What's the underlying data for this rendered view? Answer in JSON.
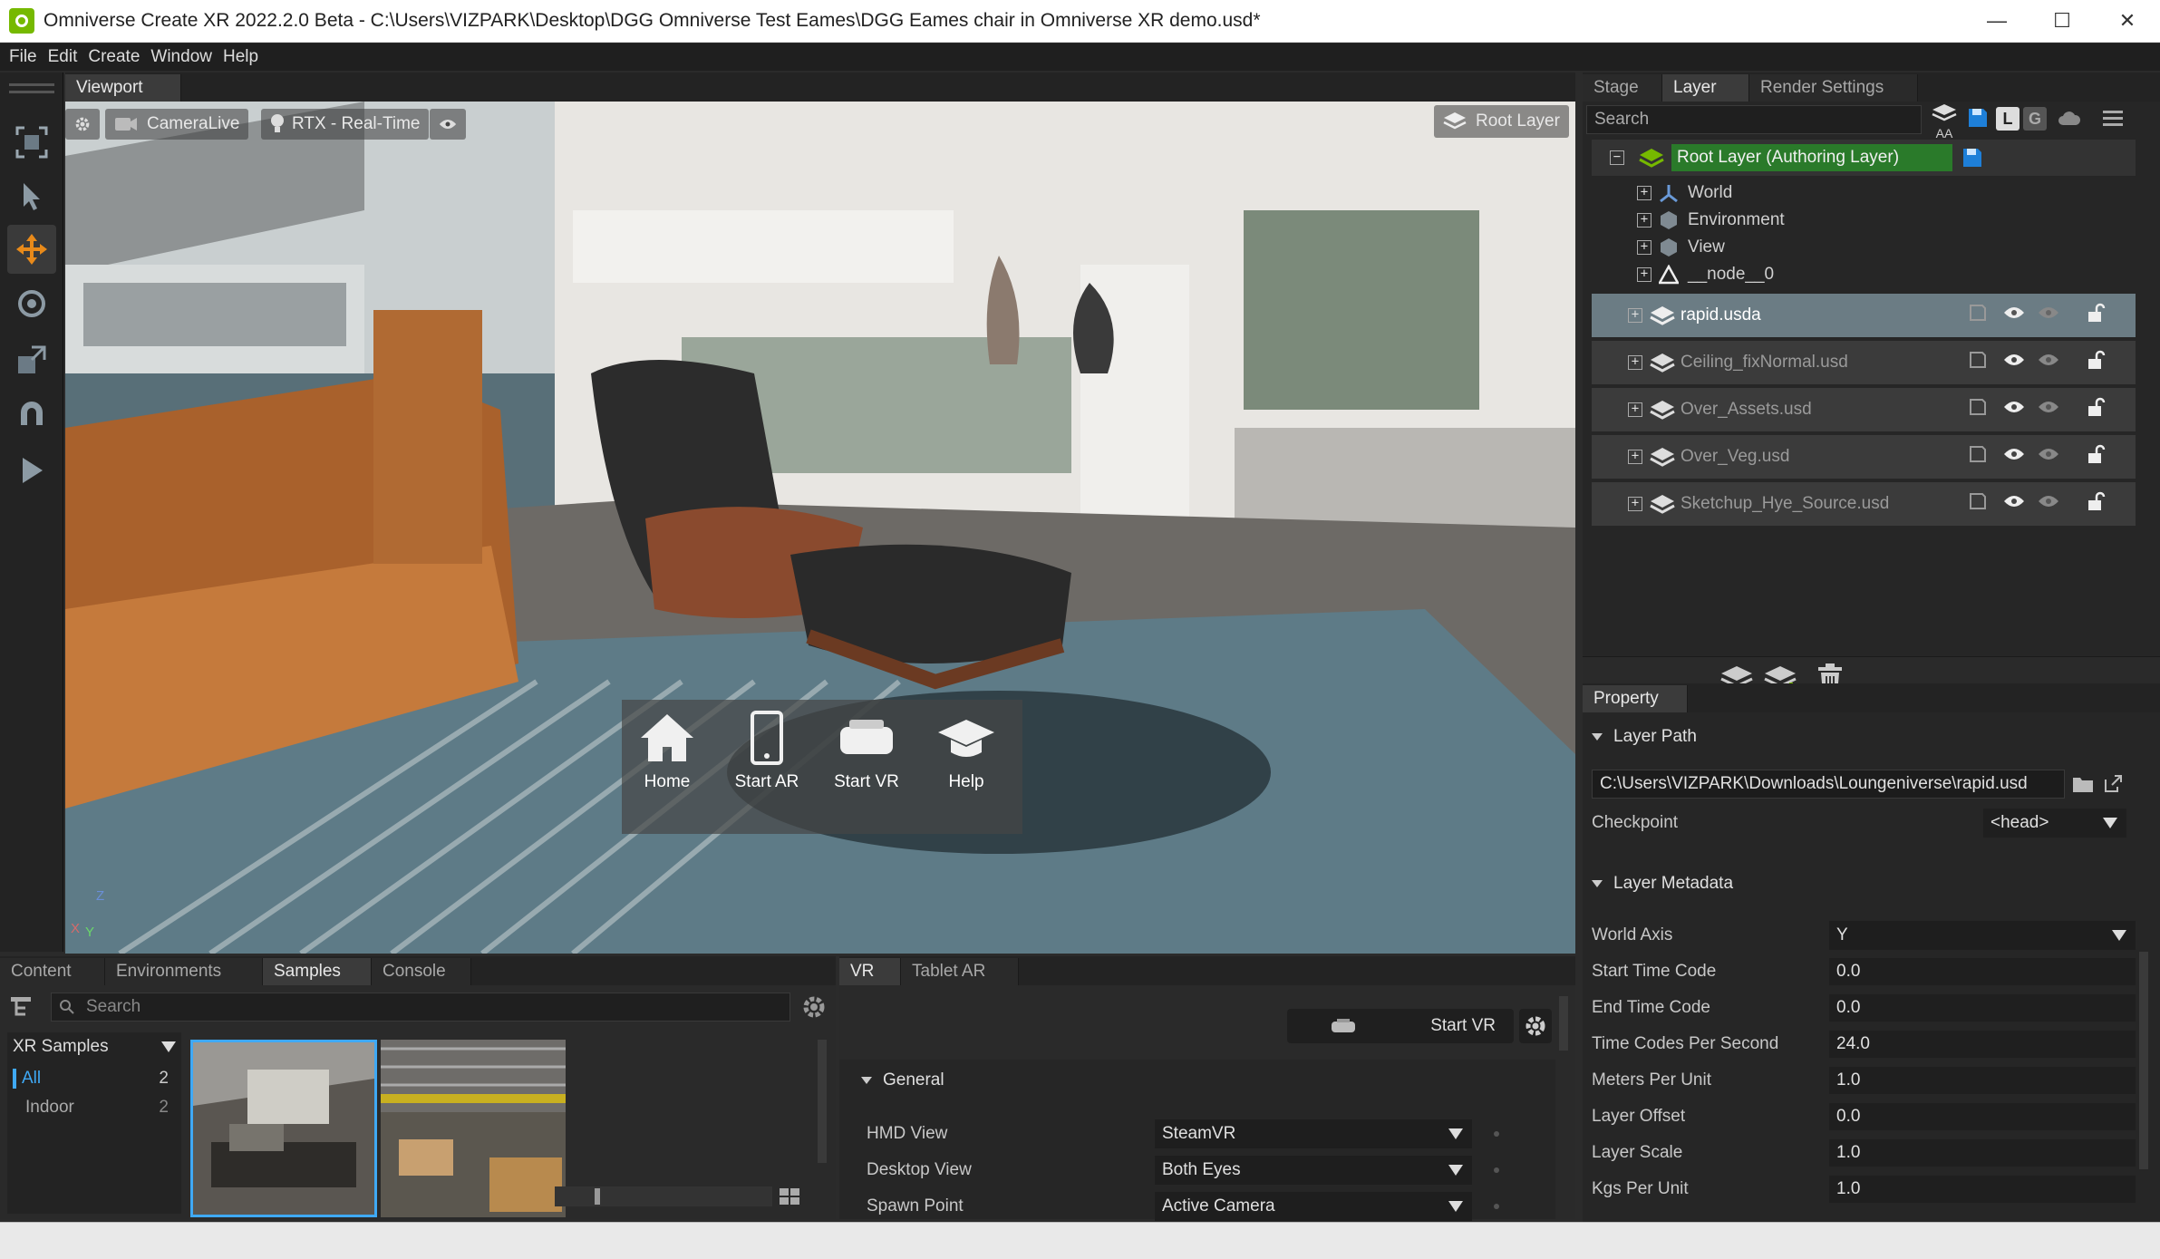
{
  "window": {
    "title": "Omniverse Create XR 2022.2.0 Beta - C:\\Users\\VIZPARK\\Desktop\\DGG Omniverse Test Eames\\DGG Eames chair in Omniverse XR demo.usd*",
    "controls": [
      "—",
      "☐",
      "✕"
    ]
  },
  "menu": [
    "File",
    "Edit",
    "Create",
    "Window",
    "Help"
  ],
  "viewport": {
    "tab": "Viewport",
    "settings_icon": "gear-icon",
    "camera_label": "CameraLive",
    "renderer_label": "RTX - Real-Time",
    "root_layer_label": "Root Layer",
    "axis_labels": {
      "z": "Z",
      "x": "X",
      "y": "Y"
    },
    "xr_menu": [
      {
        "label": "Home",
        "icon": "home-icon"
      },
      {
        "label": "Start AR",
        "icon": "tablet-icon"
      },
      {
        "label": "Start VR",
        "icon": "vr-headset-icon"
      },
      {
        "label": "Help",
        "icon": "graduation-cap-icon"
      }
    ]
  },
  "right_tabs": [
    "Stage",
    "Layer",
    "Render Settings"
  ],
  "layer": {
    "search_placeholder": "Search",
    "aa_label": "AA",
    "l_label": "L",
    "g_label": "G",
    "root": "Root Layer (Authoring Layer)",
    "tree": [
      "World",
      "Environment",
      "View",
      "__node__0"
    ],
    "sublayers": [
      {
        "name": "rapid.usda",
        "selected": true
      },
      {
        "name": "Ceiling_fixNormal.usd",
        "selected": false
      },
      {
        "name": "Over_Assets.usd",
        "selected": false
      },
      {
        "name": "Over_Veg.usd",
        "selected": false
      },
      {
        "name": "Sketchup_Hye_Source.usd",
        "selected": false
      }
    ]
  },
  "property": {
    "tab": "Property",
    "layer_path_section": "Layer Path",
    "layer_path_value": "C:\\Users\\VIZPARK\\Downloads\\Loungeniverse\\rapid.usd",
    "checkpoint_label": "Checkpoint",
    "checkpoint_value": "<head>",
    "metadata_section": "Layer Metadata",
    "world_axis_label": "World Axis",
    "world_axis_value": "Y",
    "fields": [
      {
        "label": "Start Time Code",
        "value": "0.0"
      },
      {
        "label": "End Time Code",
        "value": "0.0"
      },
      {
        "label": "Time Codes Per Second",
        "value": "24.0"
      },
      {
        "label": "Meters Per Unit",
        "value": "1.0"
      },
      {
        "label": "Layer Offset",
        "value": "0.0"
      },
      {
        "label": "Layer Scale",
        "value": "1.0"
      },
      {
        "label": "Kgs Per Unit",
        "value": "1.0"
      }
    ]
  },
  "bottom_left": {
    "tabs": [
      "Content",
      "Environments",
      "Samples",
      "Console"
    ],
    "search_placeholder": "Search",
    "samples_dropdown": "XR Samples",
    "categories": [
      {
        "label": "All",
        "count": "2"
      },
      {
        "label": "Indoor",
        "count": "2"
      }
    ]
  },
  "bottom_right": {
    "tabs": [
      "VR",
      "Tablet AR"
    ],
    "start_vr": "Start VR",
    "general_section": "General",
    "rows": [
      {
        "label": "HMD View",
        "value": "SteamVR"
      },
      {
        "label": "Desktop View",
        "value": "Both Eyes"
      },
      {
        "label": "Spawn Point",
        "value": "Active Camera"
      }
    ]
  }
}
